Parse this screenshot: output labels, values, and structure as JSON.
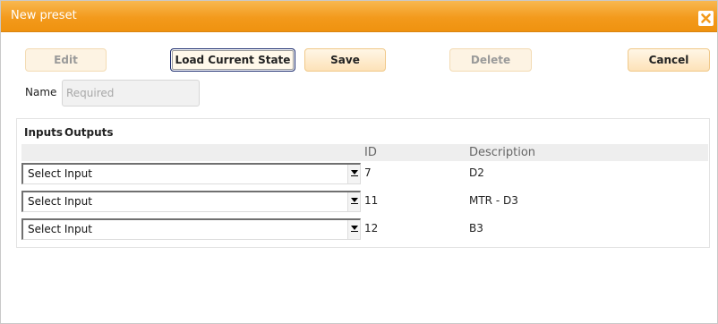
{
  "dialog": {
    "title": "New preset",
    "close_icon": "close-icon"
  },
  "toolbar": {
    "edit_label": "Edit",
    "load_current_state_label": "Load Current State",
    "save_label": "Save",
    "delete_label": "Delete",
    "cancel_label": "Cancel"
  },
  "name_field": {
    "label": "Name",
    "value": "",
    "placeholder": "Required"
  },
  "tabs": [
    "Inputs",
    "Outputs"
  ],
  "table": {
    "columns": [
      "",
      "ID",
      "Description"
    ],
    "rows": [
      {
        "select_value": "Select Input",
        "id": "7",
        "description": "D2"
      },
      {
        "select_value": "Select Input",
        "id": "11",
        "description": "MTR - D3"
      },
      {
        "select_value": "Select Input",
        "id": "12",
        "description": "B3"
      }
    ]
  },
  "colors": {
    "title_bar": "#f39a1c",
    "button_fill": "#fde2b8",
    "focus_border": "#1a2a6c"
  }
}
